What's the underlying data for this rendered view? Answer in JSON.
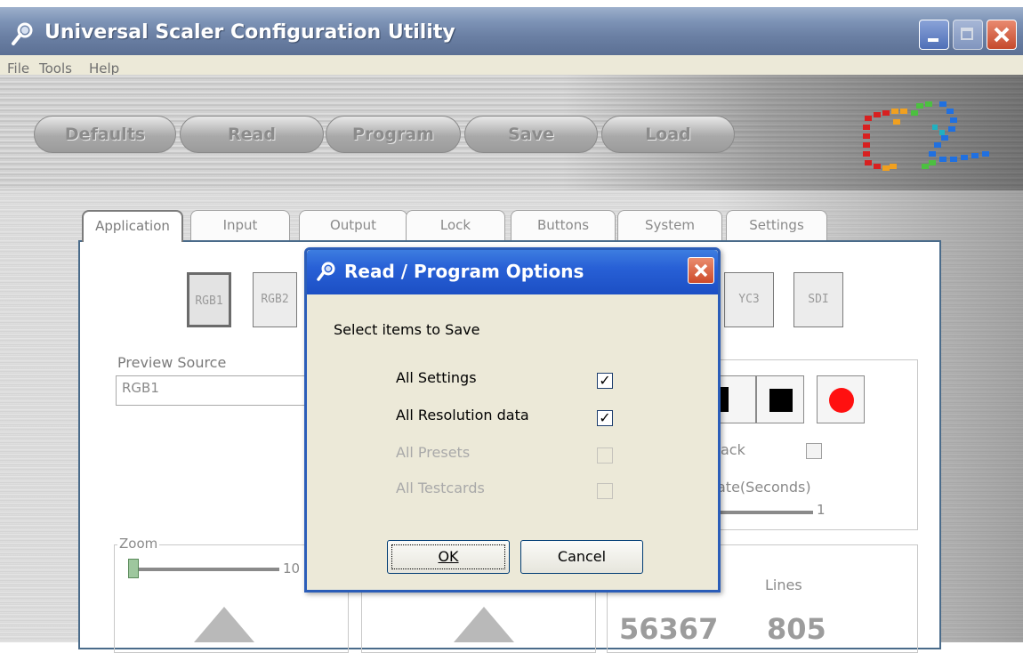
{
  "window": {
    "title": "Universal Scaler Configuration Utility"
  },
  "menu": [
    "File",
    "Tools",
    "Help"
  ],
  "toolbar": {
    "defaults": "Defaults",
    "read": "Read",
    "program": "Program",
    "save": "Save",
    "load": "Load"
  },
  "tabs": [
    "Application",
    "Input",
    "Output",
    "Lock",
    "Buttons",
    "System",
    "Settings"
  ],
  "active_tab": "Application",
  "sources": {
    "rgb1": "RGB1",
    "rgb2": "RGB2",
    "yc3": "YC3",
    "sdi": "SDI"
  },
  "preview": {
    "label": "Preview Source",
    "value": "RGB1"
  },
  "playback": {
    "loop_fragment": "ack",
    "rate_fragment": "ate(Seconds)",
    "rate_value": "1"
  },
  "zoom": {
    "label": "Zoom",
    "value_fragment": "10"
  },
  "stats": {
    "lines_label": "Lines",
    "value_a": "56367",
    "value_b": "805"
  },
  "dialog": {
    "title": "Read / Program Options",
    "prompt": "Select items to Save",
    "options": [
      {
        "label": "All Settings",
        "checked": true,
        "enabled": true
      },
      {
        "label": "All Resolution data",
        "checked": true,
        "enabled": true
      },
      {
        "label": "All Presets",
        "checked": false,
        "enabled": false
      },
      {
        "label": "All Testcards",
        "checked": false,
        "enabled": false
      }
    ],
    "ok_label": "OK",
    "cancel_label": "Cancel"
  },
  "colors": {
    "titlebar": "#7d93b6",
    "dialog_titlebar": "#2860d6",
    "close_red": "#cd4a2a",
    "record_red": "#ff1010",
    "panel_border": "#4a6b8a"
  },
  "icons": {
    "app": "magnifier-wrench-icon",
    "close": "close-icon",
    "minimize": "minimize-icon",
    "maximize": "maximize-icon"
  }
}
